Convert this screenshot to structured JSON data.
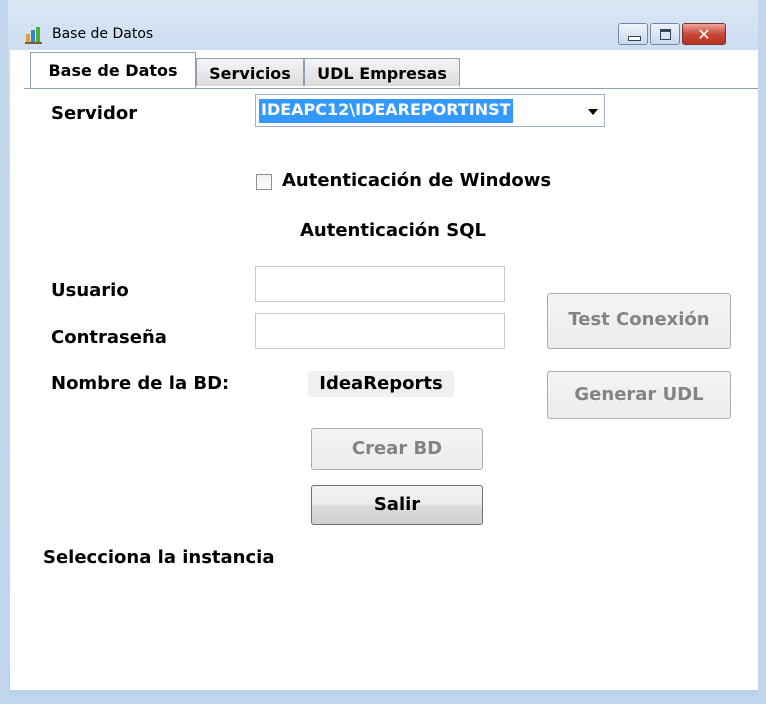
{
  "window": {
    "title": "Base de Datos",
    "close_glyph": "✕"
  },
  "tabs": [
    {
      "label": "Base de Datos",
      "active": true
    },
    {
      "label": "Servicios",
      "active": false
    },
    {
      "label": "UDL Empresas",
      "active": false
    }
  ],
  "form": {
    "servidor_label": "Servidor",
    "servidor_value": "IDEAPC12\\IDEAREPORTINST",
    "windows_auth_label": "Autenticación de Windows",
    "windows_auth_checked": false,
    "sql_auth_heading": "Autenticación SQL",
    "usuario_label": "Usuario",
    "usuario_value": "",
    "password_label": "Contraseña",
    "password_value": "",
    "bd_name_label": "Nombre de la BD:",
    "bd_name_value": "IdeaReports"
  },
  "buttons": {
    "test_conexion": "Test Conexión",
    "generar_udl": "Generar UDL",
    "crear_bd": "Crear BD",
    "salir": "Salir"
  },
  "status": {
    "message": "Selecciona la instancia"
  },
  "colors": {
    "selection": "#3399ff",
    "close_button": "#c8493a"
  },
  "icons": {
    "app": "database-chart-icon",
    "minimize": "minimize-icon",
    "maximize": "maximize-icon",
    "close": "close-icon",
    "dropdown": "chevron-down-icon"
  }
}
